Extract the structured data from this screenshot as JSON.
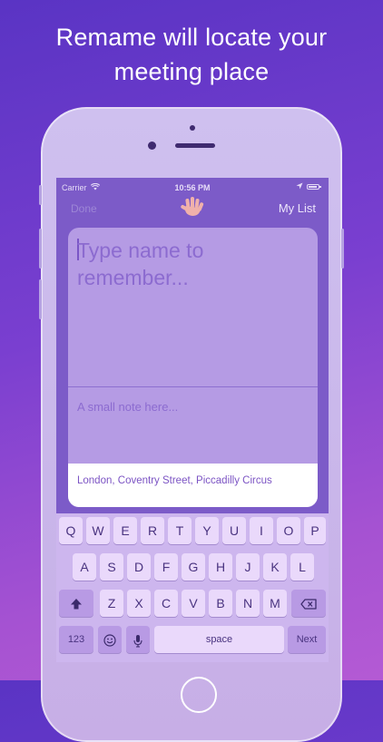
{
  "headline": {
    "line1": "Remame will locate your",
    "line2": "meeting place"
  },
  "status_bar": {
    "carrier": "Carrier",
    "time": "10:56 PM"
  },
  "nav": {
    "done_label": "Done",
    "my_list_label": "My List"
  },
  "form": {
    "name_placeholder": "Type name to remember...",
    "note_placeholder": "A small note here...",
    "location_value": "London, Coventry Street, Piccadilly Circus"
  },
  "keyboard": {
    "row1": [
      "Q",
      "W",
      "E",
      "R",
      "T",
      "Y",
      "U",
      "I",
      "O",
      "P"
    ],
    "row2": [
      "A",
      "S",
      "D",
      "F",
      "G",
      "H",
      "J",
      "K",
      "L"
    ],
    "row3": [
      "Z",
      "X",
      "C",
      "V",
      "B",
      "N",
      "M"
    ],
    "numbers_label": "123",
    "space_label": "space",
    "next_label": "Next"
  },
  "colors": {
    "background_top": "#5a34c4",
    "background_bottom": "#b45ad4",
    "accent_text": "#7c54c4"
  },
  "icons": [
    "wifi-icon",
    "location-arrow-icon",
    "battery-icon",
    "hand-logo-icon",
    "shift-icon",
    "backspace-icon",
    "emoji-icon",
    "microphone-icon"
  ]
}
